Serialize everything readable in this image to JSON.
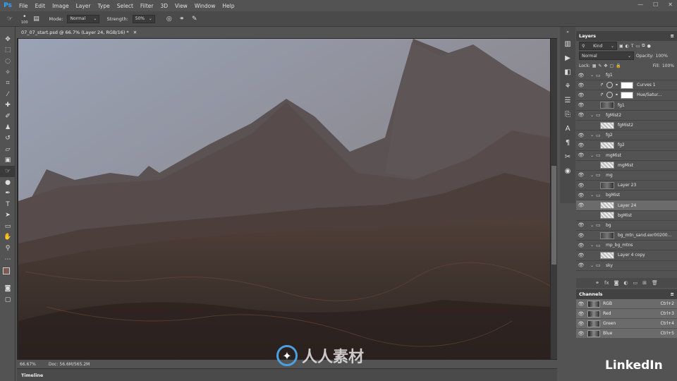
{
  "app": "Ps",
  "menu": [
    "File",
    "Edit",
    "Image",
    "Layer",
    "Type",
    "Select",
    "Filter",
    "3D",
    "View",
    "Window",
    "Help"
  ],
  "window_controls": [
    "—",
    "☐",
    "✕"
  ],
  "options": {
    "brush_size": "100",
    "mode_label": "Mode:",
    "mode_value": "Normal",
    "strength_label": "Strength:",
    "strength_value": "50%"
  },
  "document": {
    "tab_title": "07_07_start.psd @ 66.7% (Layer 24, RGB/16) *",
    "close": "✕",
    "zoom": "66.67%",
    "doc_info": "Doc: 56.6M/565.2M"
  },
  "timeline_label": "Timeline",
  "layers_panel": {
    "title": "Layers",
    "filter": "Kind",
    "blend_mode": "Normal",
    "opacity_label": "Opacity:",
    "opacity_value": "100%",
    "lock_label": "Lock:",
    "fill_label": "Fill:",
    "fill_value": "100%",
    "layers": [
      {
        "name": "fg1",
        "kind": "group",
        "visible": true,
        "indent": 0
      },
      {
        "name": "Curves 1",
        "kind": "adjustment",
        "visible": true,
        "indent": 1
      },
      {
        "name": "Hue/Satur...",
        "kind": "adjustment",
        "visible": true,
        "indent": 1
      },
      {
        "name": "fg1",
        "kind": "layer",
        "visible": true,
        "indent": 1,
        "thumb": "img"
      },
      {
        "name": "fgMist2",
        "kind": "group",
        "visible": true,
        "indent": 0
      },
      {
        "name": "fgMist2",
        "kind": "layer",
        "visible": false,
        "indent": 1
      },
      {
        "name": "fg2",
        "kind": "group",
        "visible": true,
        "indent": 0
      },
      {
        "name": "fg2",
        "kind": "layer",
        "visible": true,
        "indent": 1
      },
      {
        "name": "mgMist",
        "kind": "group",
        "visible": true,
        "indent": 0
      },
      {
        "name": "mgMist",
        "kind": "layer",
        "visible": false,
        "indent": 1
      },
      {
        "name": "mg",
        "kind": "group",
        "visible": true,
        "indent": 0
      },
      {
        "name": "Layer 23",
        "kind": "layer",
        "visible": true,
        "indent": 1,
        "thumb": "img"
      },
      {
        "name": "bgMist",
        "kind": "group",
        "visible": true,
        "indent": 0
      },
      {
        "name": "Layer 24",
        "kind": "layer",
        "visible": true,
        "indent": 1,
        "selected": true
      },
      {
        "name": "bgMist",
        "kind": "layer",
        "visible": false,
        "indent": 1
      },
      {
        "name": "bg",
        "kind": "group",
        "visible": true,
        "indent": 0
      },
      {
        "name": "bg_mtn_sand.exr00200...",
        "kind": "layer",
        "visible": true,
        "indent": 1,
        "thumb": "img"
      },
      {
        "name": "mp_bg_mtns",
        "kind": "group",
        "visible": true,
        "indent": 0
      },
      {
        "name": "Layer 4 copy",
        "kind": "layer",
        "visible": true,
        "indent": 1
      },
      {
        "name": "sky",
        "kind": "group",
        "visible": true,
        "indent": 0
      }
    ],
    "footer_icons": [
      "link-icon",
      "fx-icon",
      "mask-icon",
      "adjustment-icon",
      "folder-icon",
      "new-layer-icon",
      "trash-icon"
    ]
  },
  "channels_panel": {
    "title": "Channels",
    "channels": [
      {
        "name": "RGB",
        "shortcut": "Ctrl+2"
      },
      {
        "name": "Red",
        "shortcut": "Ctrl+3"
      },
      {
        "name": "Green",
        "shortcut": "Ctrl+4"
      },
      {
        "name": "Blue",
        "shortcut": "Ctrl+5"
      }
    ]
  },
  "watermark_text": "人人素材",
  "brand": "LinkedIn"
}
